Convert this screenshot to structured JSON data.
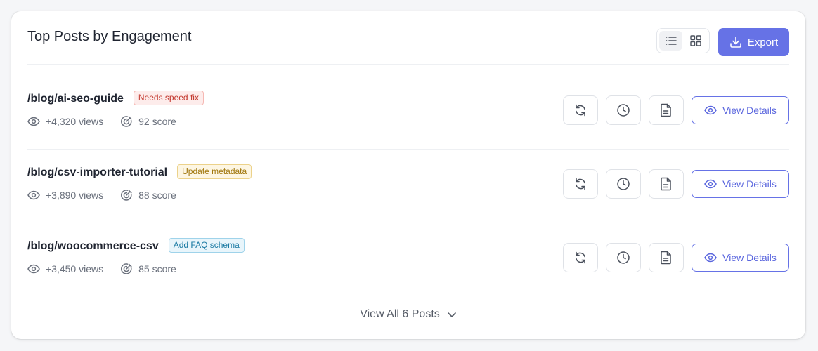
{
  "header": {
    "title": "Top Posts by Engagement",
    "export_label": "Export",
    "view_modes": [
      "list-icon",
      "grid-icon"
    ],
    "active_view": "list"
  },
  "posts": [
    {
      "path": "/blog/ai-seo-guide",
      "tag": "Needs speed fix",
      "tag_color": "red",
      "views": "+4,320 views",
      "score": "92 score",
      "details_label": "View Details"
    },
    {
      "path": "/blog/csv-importer-tutorial",
      "tag": "Update metadata",
      "tag_color": "yellow",
      "views": "+3,890 views",
      "score": "88 score",
      "details_label": "View Details"
    },
    {
      "path": "/blog/woocommerce-csv",
      "tag": "Add FAQ schema",
      "tag_color": "blue",
      "views": "+3,450 views",
      "score": "85 score",
      "details_label": "View Details"
    }
  ],
  "footer": {
    "view_all_label": "View All 6 Posts"
  },
  "colors": {
    "accent": "#6672e6",
    "tag_red": "#c2352b",
    "tag_yellow": "#a0760b",
    "tag_blue": "#1a7aa3"
  },
  "icons": {
    "row_actions": [
      "refresh-icon",
      "clock-icon",
      "document-icon"
    ],
    "views": "eye-icon",
    "score": "target-icon",
    "export": "download-icon",
    "footer": "chevron-down-icon"
  }
}
